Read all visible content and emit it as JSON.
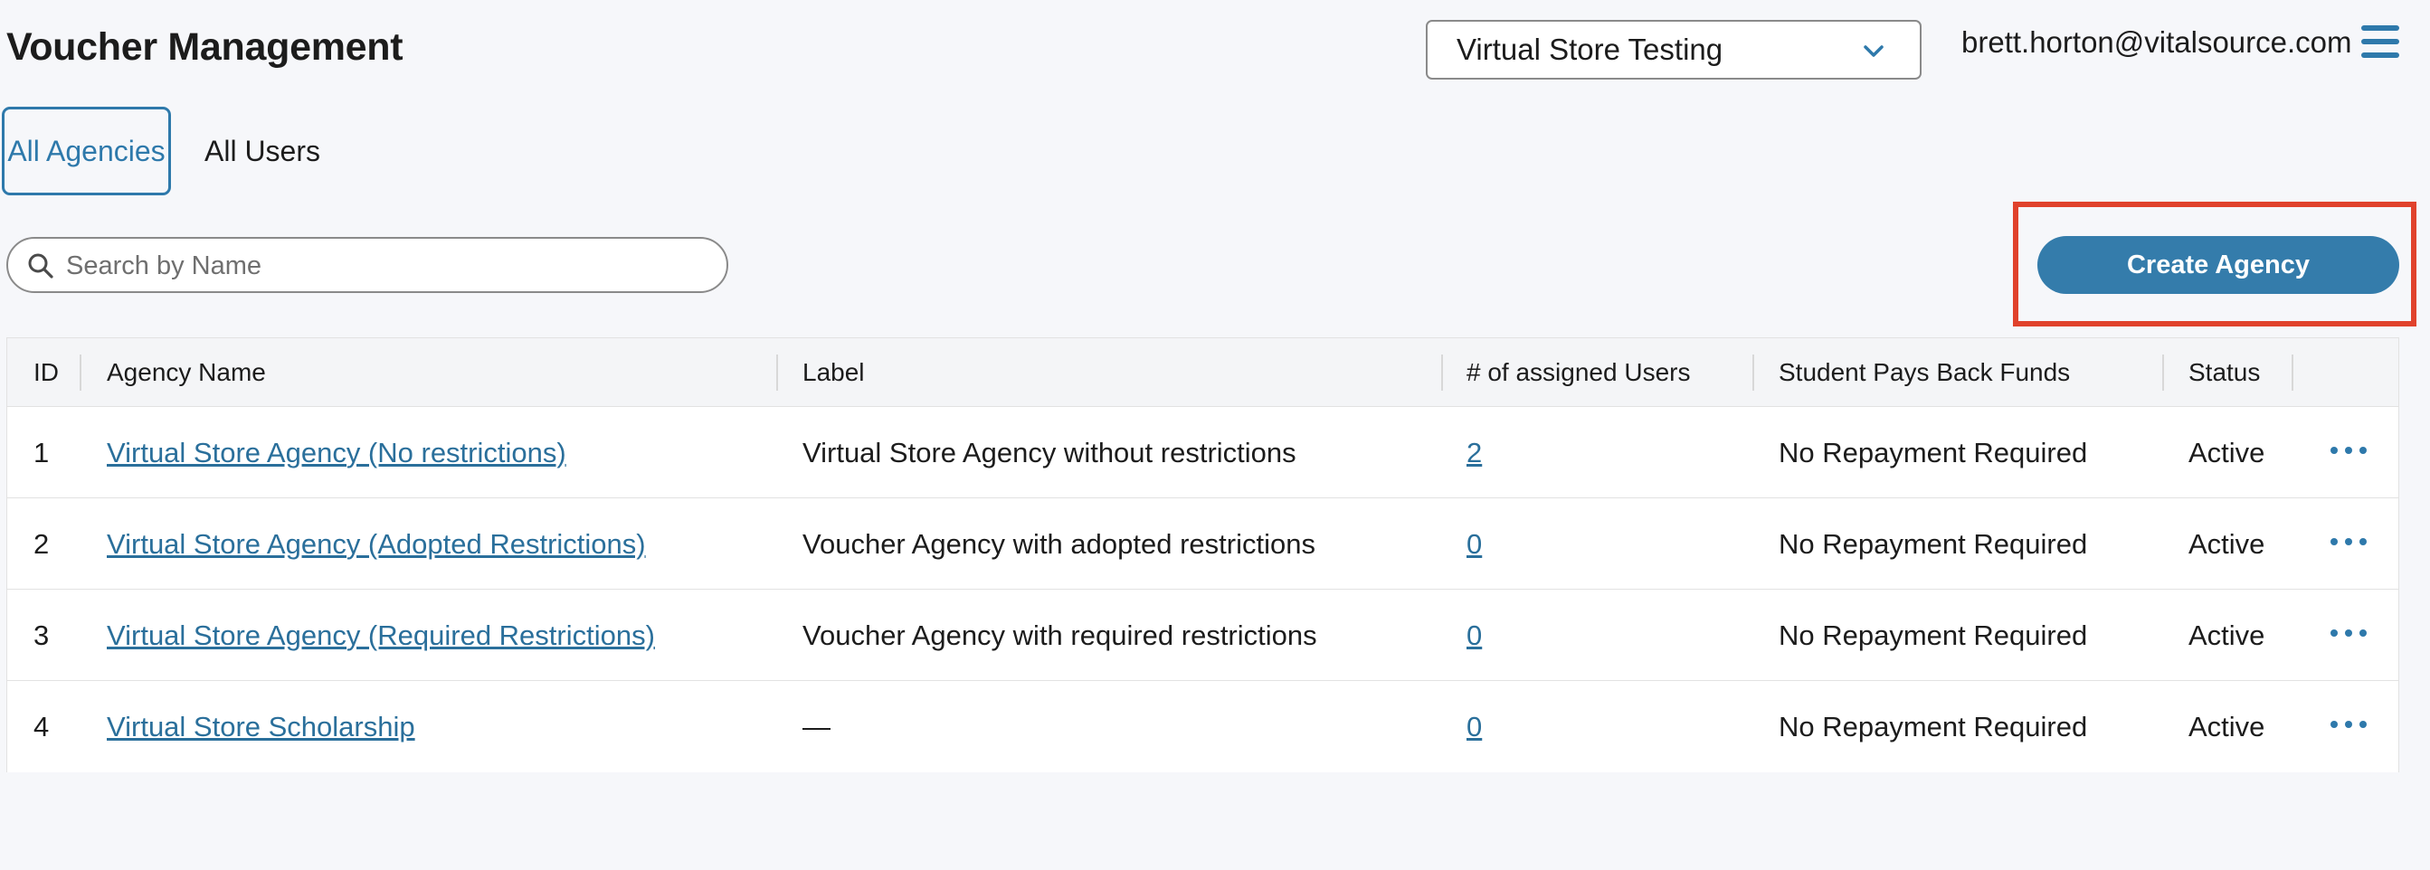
{
  "header": {
    "title": "Voucher Management",
    "store_selector": "Virtual Store Testing",
    "user_email": "brett.horton@vitalsource.com"
  },
  "tabs": [
    {
      "label": "All Agencies",
      "active": true
    },
    {
      "label": "All Users",
      "active": false
    }
  ],
  "search": {
    "placeholder": "Search by Name",
    "value": ""
  },
  "actions": {
    "create_label": "Create Agency"
  },
  "table": {
    "columns": [
      "ID",
      "Agency Name",
      "Label",
      "# of assigned Users",
      "Student Pays Back Funds",
      "Status"
    ],
    "rows": [
      {
        "id": "1",
        "name": "Virtual Store Agency (No restrictions)",
        "label": "Virtual Store Agency without restrictions",
        "users": "2",
        "pays": "No Repayment Required",
        "status": "Active"
      },
      {
        "id": "2",
        "name": "Virtual Store Agency (Adopted Restrictions)",
        "label": "Voucher Agency with adopted restrictions",
        "users": "0",
        "pays": "No Repayment Required",
        "status": "Active"
      },
      {
        "id": "3",
        "name": "Virtual Store Agency (Required Restrictions)",
        "label": "Voucher Agency with required restrictions",
        "users": "0",
        "pays": "No Repayment Required",
        "status": "Active"
      },
      {
        "id": "4",
        "name": "Virtual Store Scholarship",
        "label": "—",
        "users": "0",
        "pays": "No Repayment Required",
        "status": "Active"
      }
    ]
  },
  "colors": {
    "accent": "#2e79ab",
    "link": "#2a6f9b",
    "highlight": "#e0422c",
    "background": "#f6f7fa"
  }
}
